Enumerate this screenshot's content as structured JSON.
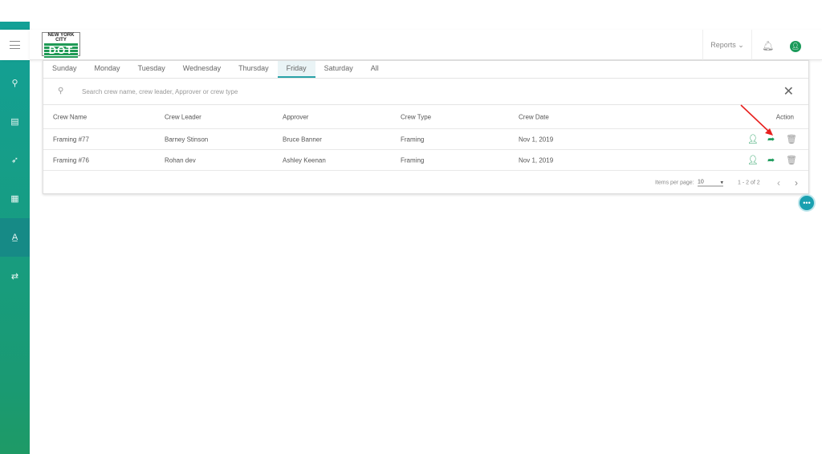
{
  "header": {
    "logo_text": "NEW YORK CITY",
    "logo_mark": "DOT",
    "reports_label": "Reports"
  },
  "tabs": [
    "Sunday",
    "Monday",
    "Tuesday",
    "Wednesday",
    "Thursday",
    "Friday",
    "Saturday",
    "All"
  ],
  "active_tab": "Friday",
  "search": {
    "placeholder": "Search crew name, crew leader, Approver or crew type"
  },
  "table": {
    "columns": [
      "Crew Name",
      "Crew Leader",
      "Approver",
      "Crew Type",
      "Crew Date",
      "Action"
    ],
    "rows": [
      [
        "Framing #77",
        "Barney Stinson",
        "Bruce Banner",
        "Framing",
        "Nov 1, 2019"
      ],
      [
        "Framing #76",
        "Rohan dev",
        "Ashley Keenan",
        "Framing",
        "Nov 1, 2019"
      ]
    ]
  },
  "pagination": {
    "items_per_page_label": "Items per page:",
    "items_per_page": "10",
    "range": "1 - 2 of 2"
  },
  "colors": {
    "accent": "#1b9a5a",
    "teal": "#13a096",
    "arrow": "#e8201e"
  }
}
